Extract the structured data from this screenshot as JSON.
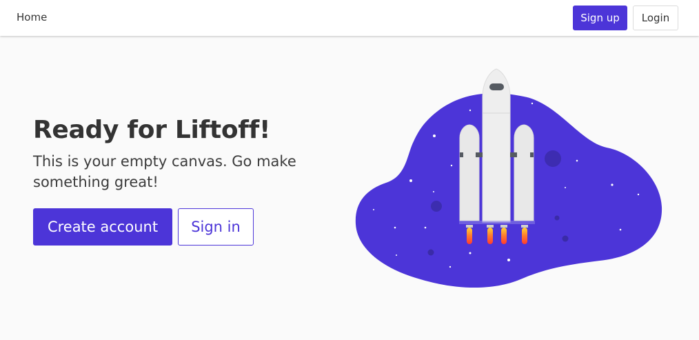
{
  "navbar": {
    "home_label": "Home",
    "signup_label": "Sign up",
    "login_label": "Login"
  },
  "hero": {
    "title": "Ready for Liftoff!",
    "subtitle": "This is your empty canvas. Go make something great!",
    "create_account_label": "Create account",
    "sign_in_label": "Sign in"
  },
  "illustration": {
    "name": "rocket-launch-illustration"
  },
  "colors": {
    "accent": "#4c35d8",
    "blob": "#4c35d8",
    "page_background": "#fafafa",
    "text": "#333333"
  }
}
